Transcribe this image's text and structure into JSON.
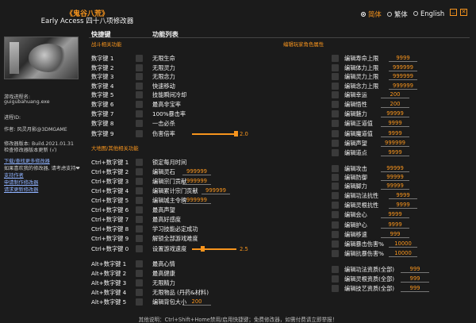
{
  "header": {
    "game_title": "《鬼谷八荒》",
    "app_title": "Early Access 四十八项修改器",
    "languages": [
      {
        "label": "简体",
        "selected": true
      },
      {
        "label": "繁体",
        "selected": false
      },
      {
        "label": "English",
        "selected": false
      }
    ],
    "minimize_glyph": "_",
    "close_glyph": "✕"
  },
  "colors": {
    "accent": "#f7941d",
    "background": "#1b1b1b",
    "link": "#8fb2ff"
  },
  "sidebar": {
    "process_label": "游戏进程名:",
    "process_name": "guigubahuang.exe",
    "pid_label": "进程ID:",
    "author": "作者: 风灵月影@3DMGAME",
    "version": "修改器版本: Build.2021.01.31",
    "update_check": "检查修改器版本更新 (√)",
    "links": [
      "下载/查找更多修改器",
      "如果喜欢我的修改器, 请考虑支持❤",
      "支持作者",
      "申请制作修改器",
      "请求更新修改器"
    ]
  },
  "columns": {
    "hotkey": "快捷键",
    "features": "功能列表"
  },
  "sections": {
    "battle": "战斗相关功能",
    "map": "大地图/其他相关功能",
    "edit": "编辑玩家角色属性"
  },
  "left_rows": [
    {
      "key": "数字键 1",
      "label": "无限生命"
    },
    {
      "key": "数字键 2",
      "label": "无限灵力"
    },
    {
      "key": "数字键 3",
      "label": "无限念力"
    },
    {
      "key": "数字键 4",
      "label": "快速移动"
    },
    {
      "key": "数字键 5",
      "label": "技能瞬间冷却"
    },
    {
      "key": "数字键 6",
      "label": "最高非宝率"
    },
    {
      "key": "数字键 7",
      "label": "100%暴击率"
    },
    {
      "key": "数字键 8",
      "label": "一击必杀"
    },
    {
      "key": "数字键 9",
      "label": "伤害倍率",
      "slider": "2.0",
      "fill": 1.0
    },
    {
      "key": "Ctrl+数字键 1",
      "label": "锁定每月时间"
    },
    {
      "key": "Ctrl+数字键 2",
      "label": "编辑灵石",
      "value": "999999"
    },
    {
      "key": "Ctrl+数字键 3",
      "label": "编辑宗门贡献",
      "value": "999999"
    },
    {
      "key": "Ctrl+数字键 4",
      "label": "编辑累计宗门贡献",
      "value": "999999"
    },
    {
      "key": "Ctrl+数字键 5",
      "label": "编辑城主令牌",
      "value": "999999"
    },
    {
      "key": "Ctrl+数字键 6",
      "label": "最高声望"
    },
    {
      "key": "Ctrl+数字键 7",
      "label": "最高好感度"
    },
    {
      "key": "Ctrl+数字键 8",
      "label": "学习技能必定成功"
    },
    {
      "key": "Ctrl+数字键 9",
      "label": "解锁全部游戏难度"
    },
    {
      "key": "Ctrl+数字键 0",
      "label": "设置游戏速度",
      "slider": "2.5",
      "fill": 0.25
    },
    {
      "key": "Alt+数字键 1",
      "label": "最高心情"
    },
    {
      "key": "Alt+数字键 2",
      "label": "最高健康"
    },
    {
      "key": "Alt+数字键 3",
      "label": "无限精力"
    },
    {
      "key": "Alt+数字键 4",
      "label": "无限物品 (丹药&材料)"
    },
    {
      "key": "Alt+数字键 5",
      "label": "编辑背包大小",
      "value": "200"
    }
  ],
  "right_rows": [
    {
      "label": "编辑寿命上限",
      "value": "9999"
    },
    {
      "label": "编辑体力上限",
      "value": "999999"
    },
    {
      "label": "编辑灵力上限",
      "value": "999999"
    },
    {
      "label": "编辑念力上限",
      "value": "999999"
    },
    {
      "label": "编辑幸运",
      "value": "200"
    },
    {
      "label": "编辑悟性",
      "value": "200"
    },
    {
      "label": "编辑魅力",
      "value": "99999"
    },
    {
      "label": "编辑正道值",
      "value": "9999"
    },
    {
      "label": "编辑魔道值",
      "value": "9999"
    },
    {
      "label": "编辑声望",
      "value": "999999"
    },
    {
      "label": "编辑道点",
      "value": "9999"
    },
    {
      "label": "编辑攻击",
      "value": "99999"
    },
    {
      "label": "编辑防御",
      "value": "99999"
    },
    {
      "label": "编辑脚力",
      "value": "99999"
    },
    {
      "label": "编辑功法抗性",
      "value": "9999"
    },
    {
      "label": "编辑灵根抗性",
      "value": "9999"
    },
    {
      "label": "编辑会心",
      "value": "9999"
    },
    {
      "label": "编辑护心",
      "value": "9999"
    },
    {
      "label": "编辑移速",
      "value": "999"
    },
    {
      "label": "编辑暴击伤害%",
      "value": "10000"
    },
    {
      "label": "编辑抗暴伤害%",
      "value": "10000"
    },
    {
      "label": "编辑功法资质(全部)",
      "value": "999"
    },
    {
      "label": "编辑灵根资质(全部)",
      "value": "999"
    },
    {
      "label": "编辑技艺资质(全部)",
      "value": "999"
    }
  ],
  "footer": "其他说明：Ctrl+Shift+Home禁用/启用快捷键；免费修改器，如需付费请立即举报！"
}
